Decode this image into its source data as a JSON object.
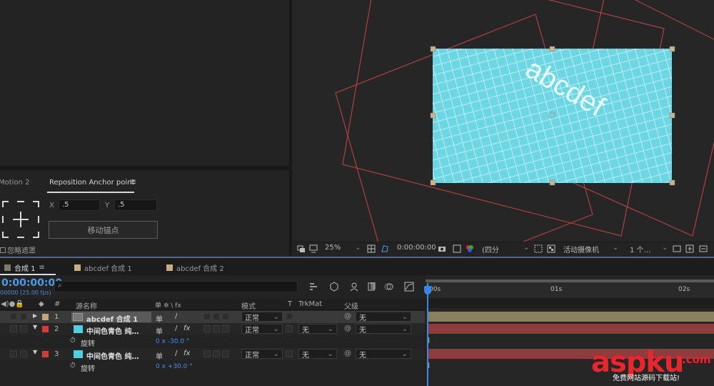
{
  "effects_panel": {
    "tab_prev": "Motion 2",
    "tab_active": "Reposition Anchor point",
    "menu_icon": "≡",
    "x_label": "X",
    "x_value": ".5",
    "y_label": "Y",
    "y_value": ".5",
    "move_button": "移动锚点",
    "ignore_mask_label": "忽略遮罩"
  },
  "viewer": {
    "layer_text": "abcdef",
    "zoom": "25%",
    "timecode": "0:00:00:00",
    "resolution": "(四分",
    "camera": "活动摄像机",
    "views": "1 个…"
  },
  "timeline": {
    "tabs": [
      {
        "label": "合成 1",
        "color": "#7f7a6a",
        "active": true
      },
      {
        "label": "abcdef 合成 1",
        "color": "#c8ad82",
        "active": false
      },
      {
        "label": "abcdef 合成 2",
        "color": "#c8ad82",
        "active": false
      }
    ],
    "time": "0:00:00:00",
    "fps": "00000 (25.00 fps)",
    "columns": {
      "hash": "#",
      "source_name": "源名称",
      "switches": "单 ✲ \\ fx",
      "mode": "模式",
      "t": "T",
      "trkmat": "TrkMat",
      "parent": "父级"
    },
    "ruler_labels": [
      "00s",
      "01s",
      "02s"
    ],
    "layers": [
      {
        "num": "1",
        "name": "abcdef 合成 1",
        "color": "#c2a37c",
        "mode": "正常",
        "trkmat": "",
        "parent": "无",
        "bar_color": "#8c7f5e"
      },
      {
        "num": "2",
        "name": "中间色青色 纯…",
        "color": "#d43b3b",
        "mode": "正常",
        "trkmat": "无",
        "parent": "无",
        "bar_color": "#8f3c3c",
        "prop_label": "旋转",
        "prop_value": "0 x -30.0 °"
      },
      {
        "num": "3",
        "name": "中间色青色 纯…",
        "color": "#d43b3b",
        "mode": "正常",
        "trkmat": "无",
        "parent": "无",
        "bar_color": "#8f3c3c",
        "prop_label": "旋转",
        "prop_value": "0 x +30.0 °"
      }
    ]
  },
  "watermark": {
    "main": "aspku",
    "suffix": ".com",
    "subtitle": "免费网站源码下载站!"
  }
}
